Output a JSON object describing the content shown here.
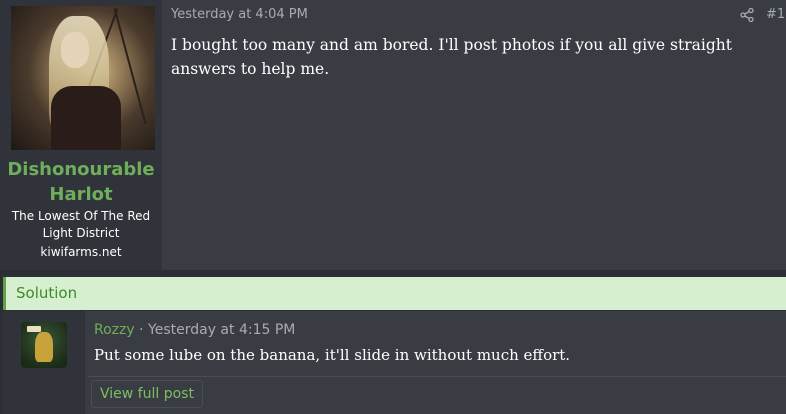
{
  "post": {
    "user": {
      "name": "Dishonourable Harlot",
      "title": "The Lowest Of The Red Light District",
      "site": "kiwifarms.net"
    },
    "time": "Yesterday at 4:04 PM",
    "number": "#1",
    "body": "I bought too many and am bored. I'll post photos if you all give straight answers to help me.",
    "share_icon": "share-icon"
  },
  "solution": {
    "label": "Solution",
    "reply": {
      "user": "Rozzy",
      "separator": "·",
      "time": "Yesterday at 4:15 PM",
      "body": "Put some lube on the banana, it'll slide in without much effort."
    },
    "view_full_label": "View full post"
  },
  "colors": {
    "username": "#6fae5a",
    "solution_bg": "#d6f0cf",
    "solution_accent": "#5ea34a"
  }
}
